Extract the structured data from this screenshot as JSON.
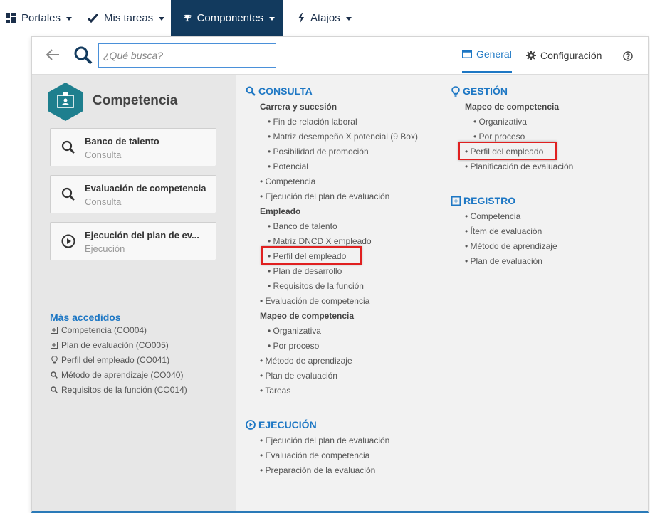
{
  "topnav": {
    "items": [
      {
        "label": "Portales",
        "icon": "dashboard-icon"
      },
      {
        "label": "Mis tareas",
        "icon": "check-icon"
      },
      {
        "label": "Componentes",
        "icon": "trophy-icon"
      },
      {
        "label": "Atajos",
        "icon": "bolt-icon"
      }
    ]
  },
  "header": {
    "search_placeholder": "¿Qué busca?",
    "tab_general": "General",
    "tab_config": "Configuración"
  },
  "left": {
    "title": "Competencia",
    "cards": [
      {
        "title": "Banco de talento",
        "subtitle": "Consulta",
        "icon": "search-icon"
      },
      {
        "title": "Evaluación de competencia",
        "subtitle": "Consulta",
        "icon": "search-icon"
      },
      {
        "title": "Ejecución del plan de ev...",
        "subtitle": "Ejecución",
        "icon": "play-circle-icon"
      }
    ],
    "mas_accedidos_title": "Más accedidos",
    "mas_accedidos": [
      {
        "label": "Competencia (CO004)",
        "icon": "plus-square-icon"
      },
      {
        "label": "Plan de evaluación (CO005)",
        "icon": "plus-square-icon"
      },
      {
        "label": "Perfil del empleado (CO041)",
        "icon": "lightbulb-icon"
      },
      {
        "label": "Método de aprendizaje (CO040)",
        "icon": "search-icon"
      },
      {
        "label": "Requisitos de la función (CO014)",
        "icon": "search-icon"
      }
    ]
  },
  "consulta": {
    "title": "CONSULTA",
    "carrera_title": "Carrera y sucesión",
    "carrera_items": [
      "Fin de relación laboral",
      "Matriz desempeño X potencial (9 Box)",
      "Posibilidad de promoción",
      "Potencial"
    ],
    "items_a": [
      "Competencia",
      "Ejecución del plan de evaluación"
    ],
    "empleado_title": "Empleado",
    "empleado_items": [
      "Banco de talento",
      "Matriz DNCD X empleado",
      "Perfil del empleado",
      "Plan de desarrollo",
      "Requisitos de la función"
    ],
    "item_b": "Evaluación de competencia",
    "mapeo_title": "Mapeo de competencia",
    "mapeo_items": [
      "Organizativa",
      "Por proceso"
    ],
    "items_c": [
      "Método de aprendizaje",
      "Plan de evaluación",
      "Tareas"
    ]
  },
  "ejecucion": {
    "title": "EJECUCIÓN",
    "items": [
      "Ejecución del plan de evaluación",
      "Evaluación de competencia",
      "Preparación de la evaluación"
    ]
  },
  "gestion": {
    "title": "GESTIÓN",
    "mapeo_title": "Mapeo de competencia",
    "mapeo_items": [
      "Organizativa",
      "Por proceso"
    ],
    "items": [
      "Perfil del empleado",
      "Planificación de evaluación"
    ]
  },
  "registro": {
    "title": "REGISTRO",
    "items": [
      "Competencia",
      "Ítem de evaluación",
      "Método de aprendizaje",
      "Plan de evaluación"
    ]
  },
  "colors": {
    "accent": "#1d77c4",
    "nav_active": "#123a5e",
    "highlight": "#e02020"
  }
}
